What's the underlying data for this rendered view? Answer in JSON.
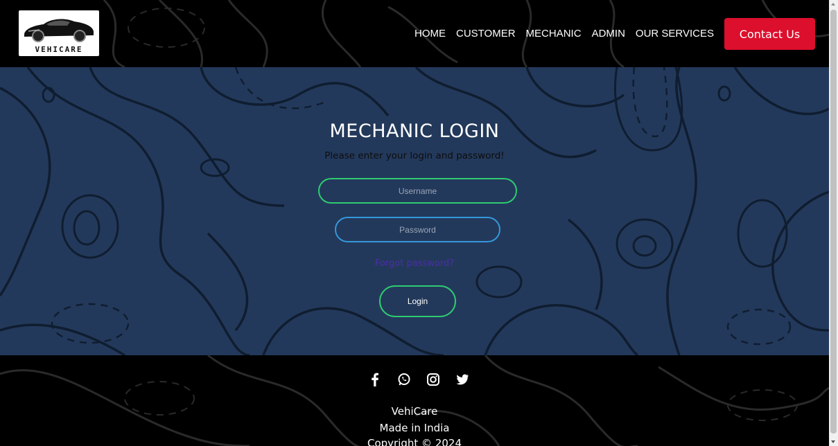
{
  "brand": {
    "logo_text": "VEHICARE"
  },
  "nav": {
    "items": [
      "HOME",
      "CUSTOMER",
      "MECHANIC",
      "ADMIN",
      "OUR SERVICES"
    ],
    "contact_label": "Contact Us"
  },
  "login": {
    "title": "MECHANIC LOGIN",
    "subtitle": "Please enter your login and password!",
    "username_placeholder": "Username",
    "password_placeholder": "Password",
    "forgot_label": "Forgot password?",
    "submit_label": "Login"
  },
  "footer": {
    "socials": [
      "facebook-icon",
      "whatsapp-icon",
      "instagram-icon",
      "twitter-icon"
    ],
    "brand": "VehiCare",
    "made_in": "Made in India",
    "copyright": "Copyright © 2024"
  },
  "colors": {
    "panel_bg": "#23395b",
    "accent_red": "#dc0f2c",
    "username_border": "#2ecc71",
    "password_border": "#3498db"
  }
}
